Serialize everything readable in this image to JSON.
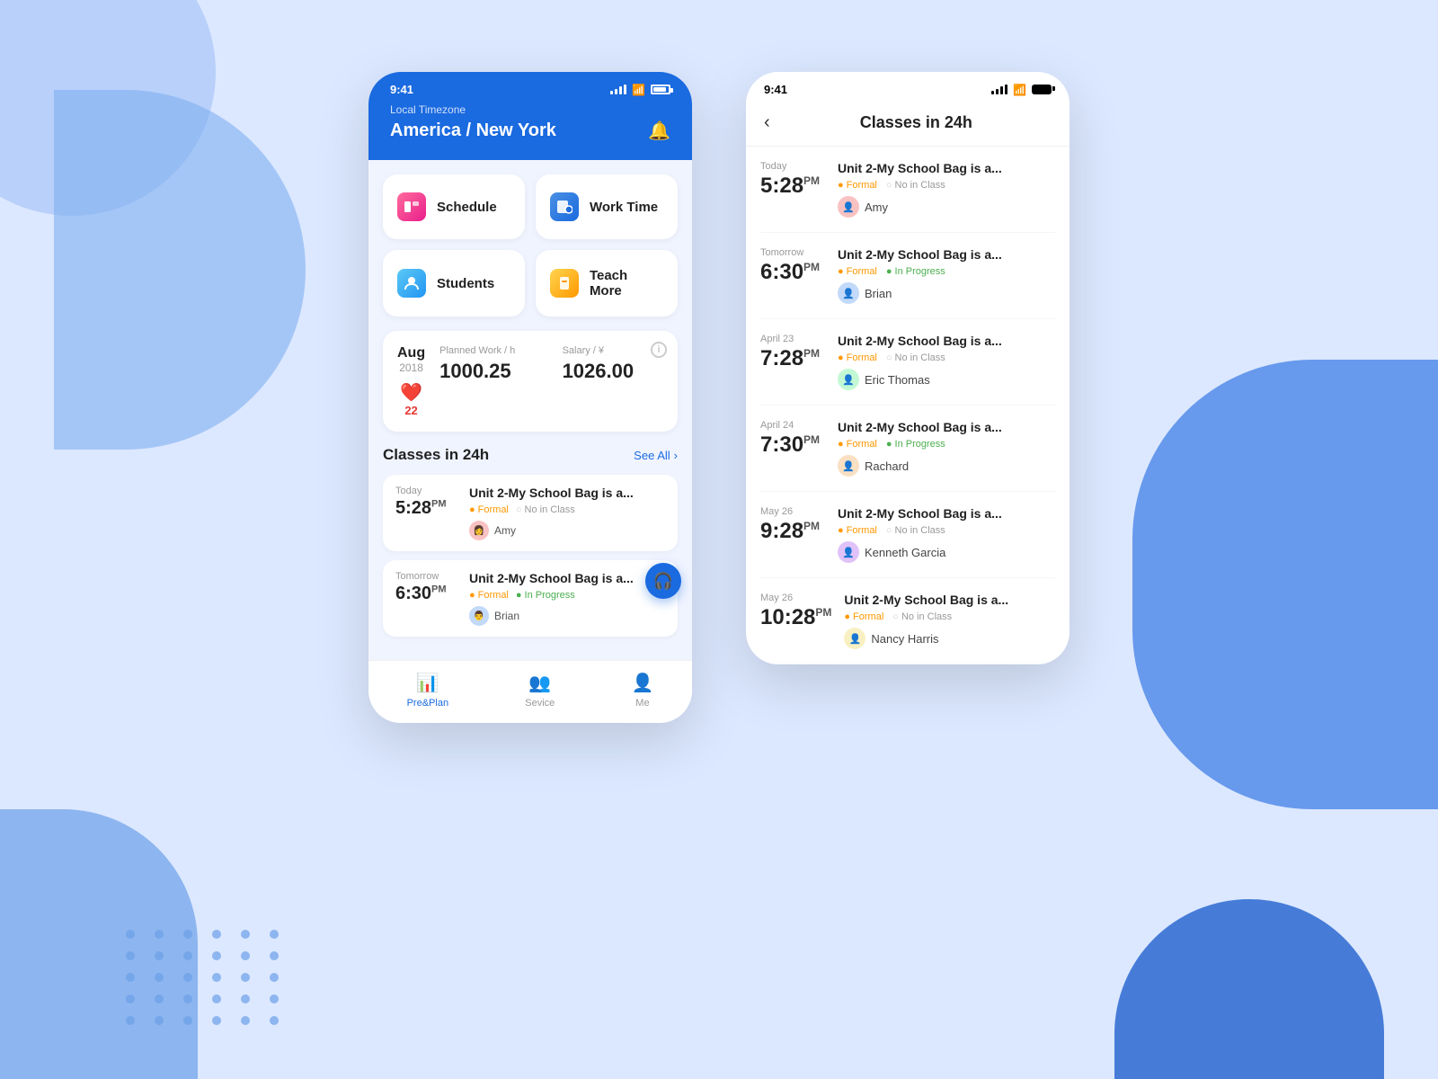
{
  "background": {
    "color": "#dce8ff"
  },
  "left_phone": {
    "status_bar": {
      "time": "9:41",
      "time_right": "9:41"
    },
    "header": {
      "timezone_label": "Local Timezone",
      "timezone_value": "America / New York"
    },
    "menu": {
      "items": [
        {
          "id": "schedule",
          "label": "Schedule",
          "icon": "📅",
          "icon_type": "schedule"
        },
        {
          "id": "work-time",
          "label": "Work Time",
          "icon": "📋",
          "icon_type": "worktime"
        },
        {
          "id": "students",
          "label": "Students",
          "icon": "👤",
          "icon_type": "students"
        },
        {
          "id": "teach-more",
          "label": "Teach More",
          "icon": "🏆",
          "icon_type": "teachmore"
        }
      ]
    },
    "stats": {
      "month": "Aug",
      "year": "2018",
      "heart_count": "22",
      "planned_work_label": "Planned Work / h",
      "salary_label": "Salary / ¥",
      "planned_work_value": "1000.25",
      "salary_value": "1026.00"
    },
    "classes_section": {
      "title": "Classes in 24h",
      "see_all": "See All",
      "items": [
        {
          "day": "Today",
          "time": "5:28",
          "period": "PM",
          "unit": "Unit 2-My School Bag is a...",
          "tag1": "Formal",
          "tag2": "No in Class",
          "tag2_style": "no-class",
          "teacher": "Amy",
          "avatar_class": "av-amy"
        },
        {
          "day": "Tomorrow",
          "time": "6:30",
          "period": "PM",
          "unit": "Unit 2-My School Bag is a...",
          "tag1": "Formal",
          "tag2": "In Progress",
          "tag2_style": "in-progress",
          "teacher": "Brian",
          "avatar_class": "av-brian"
        }
      ]
    },
    "bottom_nav": [
      {
        "id": "pre-plan",
        "label": "Pre&Plan",
        "icon": "📊",
        "active": true
      },
      {
        "id": "service",
        "label": "Sevice",
        "icon": "👥",
        "active": false
      },
      {
        "id": "me",
        "label": "Me",
        "icon": "👤",
        "active": false
      }
    ]
  },
  "right_phone": {
    "status_bar": {
      "time": "9:41"
    },
    "header": {
      "back_label": "‹",
      "title": "Classes in 24h"
    },
    "classes": [
      {
        "day": "Today",
        "time": "5:28",
        "period": "PM",
        "unit": "Unit 2-My School Bag is a...",
        "tag1": "Formal",
        "tag2": "No in Class",
        "tag2_style": "no-class",
        "teacher": "Amy",
        "avatar_class": "av-amy"
      },
      {
        "day": "Tomorrow",
        "time": "6:30",
        "period": "PM",
        "unit": "Unit 2-My School Bag is a...",
        "tag1": "Formal",
        "tag2": "In Progress",
        "tag2_style": "in-progress",
        "teacher": "Brian",
        "avatar_class": "av-brian"
      },
      {
        "day": "April 23",
        "time": "7:28",
        "period": "PM",
        "unit": "Unit 2-My School Bag is a...",
        "tag1": "Formal",
        "tag2": "No in Class",
        "tag2_style": "no-class",
        "teacher": "Eric Thomas",
        "avatar_class": "av-eric"
      },
      {
        "day": "April 24",
        "time": "7:30",
        "period": "PM",
        "unit": "Unit 2-My School Bag is a...",
        "tag1": "Formal",
        "tag2": "In Progress",
        "tag2_style": "in-progress",
        "teacher": "Rachard",
        "avatar_class": "av-rachard"
      },
      {
        "day": "May 26",
        "time": "9:28",
        "period": "PM",
        "unit": "Unit 2-My School Bag is a...",
        "tag1": "Formal",
        "tag2": "No in Class",
        "tag2_style": "no-class",
        "teacher": "Kenneth Garcia",
        "avatar_class": "av-kenneth"
      },
      {
        "day": "May 26",
        "time": "10:28",
        "period": "PM",
        "unit": "Unit 2-My School Bag is a...",
        "tag1": "Formal",
        "tag2": "No in Class",
        "tag2_style": "no-class",
        "teacher": "Nancy Harris",
        "avatar_class": "av-nancy"
      }
    ]
  }
}
